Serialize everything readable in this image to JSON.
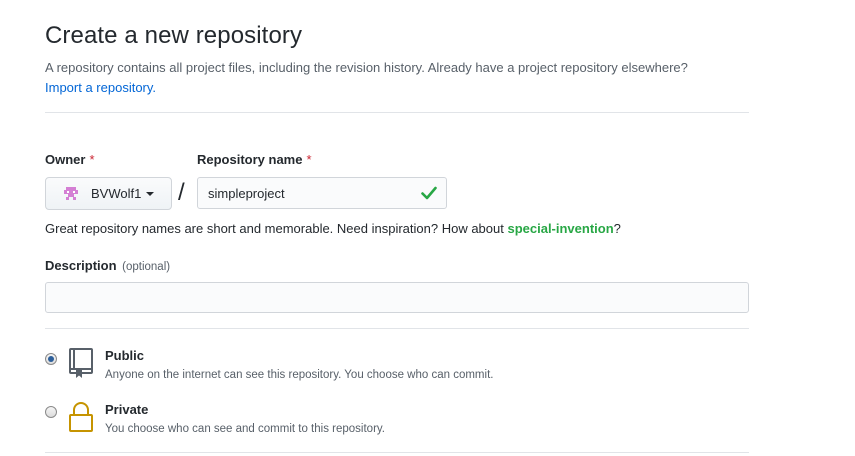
{
  "header": {
    "title": "Create a new repository",
    "subtitle": "A repository contains all project files, including the revision history. Already have a project repository elsewhere?",
    "import_link": "Import a repository."
  },
  "owner": {
    "label": "Owner",
    "required_mark": "*",
    "value": "BVWolf1"
  },
  "repo": {
    "label": "Repository name",
    "required_mark": "*",
    "value": "simpleproject",
    "valid": true
  },
  "separator": "/",
  "hint": {
    "text_before": "Great repository names are short and memorable. Need inspiration? How about ",
    "suggestion": "special-invention",
    "text_after": "?"
  },
  "description": {
    "label": "Description",
    "optional": "(optional)",
    "value": ""
  },
  "visibility": {
    "selected": "public",
    "options": [
      {
        "key": "public",
        "title": "Public",
        "desc": "Anyone on the internet can see this repository. You choose who can commit."
      },
      {
        "key": "private",
        "title": "Private",
        "desc": "You choose who can see and commit to this repository."
      }
    ]
  },
  "colors": {
    "link": "#0366d6",
    "suggestion": "#28a745",
    "required": "#cb2431",
    "check": "#28a745",
    "lock": "#c69400"
  }
}
